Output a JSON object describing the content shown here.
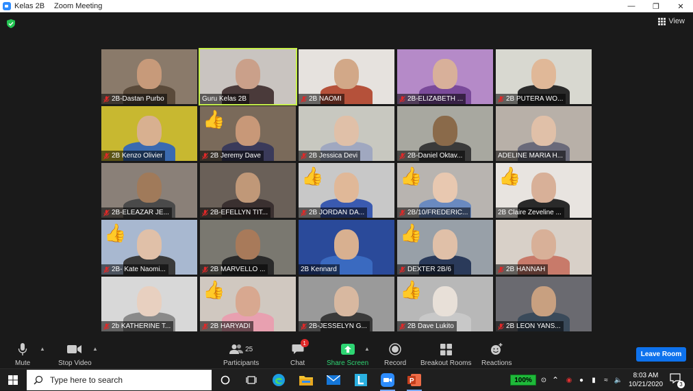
{
  "window": {
    "title": "Kelas 2B",
    "app": "Zoom Meeting",
    "controls": [
      "minimize",
      "restore",
      "close"
    ]
  },
  "meeting": {
    "view_label": "View",
    "participants_grid": [
      {
        "name": "2B-Dastan Purbo",
        "muted": true,
        "reaction": "",
        "active": false,
        "bg": "#8a7a6a",
        "face": "#c79a7a",
        "shirt": "#5a4a3a"
      },
      {
        "name": "Guru Kelas 2B",
        "muted": false,
        "reaction": "",
        "active": true,
        "bg": "#c9c4c0",
        "face": "#caa08a",
        "shirt": "#4a3a3a"
      },
      {
        "name": "2B NAOMI",
        "muted": true,
        "reaction": "",
        "active": false,
        "bg": "#e6e2de",
        "face": "#d2a888",
        "shirt": "#b5513a"
      },
      {
        "name": "2B-ELIZABETH ...",
        "muted": true,
        "reaction": "",
        "active": false,
        "bg": "#b58ac8",
        "face": "#d8b09a",
        "shirt": "#7a4a9a"
      },
      {
        "name": "2B PUTERA WO...",
        "muted": true,
        "reaction": "",
        "active": false,
        "bg": "#d8d8d0",
        "face": "#e0b898",
        "shirt": "#2a2a2a"
      },
      {
        "name": "2B Kenzo Olivier",
        "muted": true,
        "reaction": "",
        "active": false,
        "bg": "#c8b830",
        "face": "#d8b090",
        "shirt": "#3a6ab0"
      },
      {
        "name": "2B Jeremy Dave",
        "muted": true,
        "reaction": "👍",
        "active": false,
        "bg": "#7a6a5a",
        "face": "#c89878",
        "shirt": "#3a3a5a"
      },
      {
        "name": "2B Jessica Devi",
        "muted": true,
        "reaction": "",
        "active": false,
        "bg": "#c8c8c0",
        "face": "#e0c0a8",
        "shirt": "#a0a8c0"
      },
      {
        "name": "2B-Daniel Oktav...",
        "muted": true,
        "reaction": "",
        "active": false,
        "bg": "#a8a8a0",
        "face": "#8a6a4a",
        "shirt": "#3a3a3a"
      },
      {
        "name": "ADELINE MARIA H...",
        "muted": false,
        "reaction": "",
        "active": false,
        "bg": "#b8b0a8",
        "face": "#e0c0a8",
        "shirt": "#6a6a7a"
      },
      {
        "name": "2B-ELEAZAR JE...",
        "muted": true,
        "reaction": "",
        "active": false,
        "bg": "#8a8078",
        "face": "#a07a5a",
        "shirt": "#4a4a4a"
      },
      {
        "name": "2B-EFELLYN TIT...",
        "muted": true,
        "reaction": "",
        "active": false,
        "bg": "#6a6058",
        "face": "#c09878",
        "shirt": "#3a3030"
      },
      {
        "name": "2B JORDAN DA...",
        "muted": true,
        "reaction": "👍",
        "active": false,
        "bg": "#c8c8c8",
        "face": "#e0b898",
        "shirt": "#3a5ab0"
      },
      {
        "name": "2B/10/FREDERIC...",
        "muted": true,
        "reaction": "👍",
        "active": false,
        "bg": "#b8b4b0",
        "face": "#e8c8b0",
        "shirt": "#6a8ac0"
      },
      {
        "name": "2B Claire Zeveline ...",
        "muted": false,
        "reaction": "👍",
        "active": false,
        "bg": "#e8e4e0",
        "face": "#d8b098",
        "shirt": "#2a2a2a"
      },
      {
        "name": "2B- Kate Naomi...",
        "muted": true,
        "reaction": "👍",
        "active": false,
        "bg": "#a8b8d0",
        "face": "#e0c0a8",
        "shirt": "#3a3a3a"
      },
      {
        "name": "2B MARVELLO ...",
        "muted": true,
        "reaction": "",
        "active": false,
        "bg": "#7a7870",
        "face": "#a87a5a",
        "shirt": "#2a2a2a"
      },
      {
        "name": "2B Kennard",
        "muted": false,
        "reaction": "",
        "active": false,
        "bg": "#2a4a9a",
        "face": "#d8b090",
        "shirt": "#3a6ac0"
      },
      {
        "name": "DEXTER 2B/6",
        "muted": true,
        "reaction": "👍",
        "active": false,
        "bg": "#98a0a8",
        "face": "#e0c0a8",
        "shirt": "#2a3a5a"
      },
      {
        "name": "2B HANNAH",
        "muted": true,
        "reaction": "",
        "active": false,
        "bg": "#d8d0c8",
        "face": "#d8b098",
        "shirt": "#c87a6a"
      },
      {
        "name": "2b KATHERINE T...",
        "muted": true,
        "reaction": "",
        "active": false,
        "bg": "#d8d8d8",
        "face": "#e8d0c0",
        "shirt": "#8a8a8a"
      },
      {
        "name": "2B HARYADI",
        "muted": true,
        "reaction": "👍",
        "active": false,
        "bg": "#d0c8c0",
        "face": "#d8a890",
        "shirt": "#e8a0b0"
      },
      {
        "name": "2B-JESSELYN G...",
        "muted": true,
        "reaction": "",
        "active": false,
        "bg": "#9a9a9a",
        "face": "#d8b8a0",
        "shirt": "#3a3a3a"
      },
      {
        "name": "2B Dave Lukito",
        "muted": true,
        "reaction": "👍",
        "active": false,
        "bg": "#b8b8b8",
        "face": "#e8e0d8",
        "shirt": "#c8c8c8"
      },
      {
        "name": "2B LEON YANS...",
        "muted": true,
        "reaction": "",
        "active": false,
        "bg": "#6a6a70",
        "face": "#c8a080",
        "shirt": "#3a4a5a"
      }
    ]
  },
  "toolbar": {
    "mute": "Mute",
    "stop_video": "Stop Video",
    "participants": "Participants",
    "participants_count": "25",
    "chat": "Chat",
    "chat_badge": "1",
    "share_screen": "Share Screen",
    "record": "Record",
    "breakout_rooms": "Breakout Rooms",
    "reactions": "Reactions",
    "leave": "Leave Room"
  },
  "taskbar": {
    "search_placeholder": "Type here to search",
    "battery": "100%",
    "time": "8:03 AM",
    "date": "10/21/2020",
    "notification_count": "3"
  },
  "colors": {
    "accent_blue": "#0e72ed",
    "share_green": "#2ed573",
    "active_speaker": "#c7f04a",
    "muted_red": "#e02828"
  }
}
